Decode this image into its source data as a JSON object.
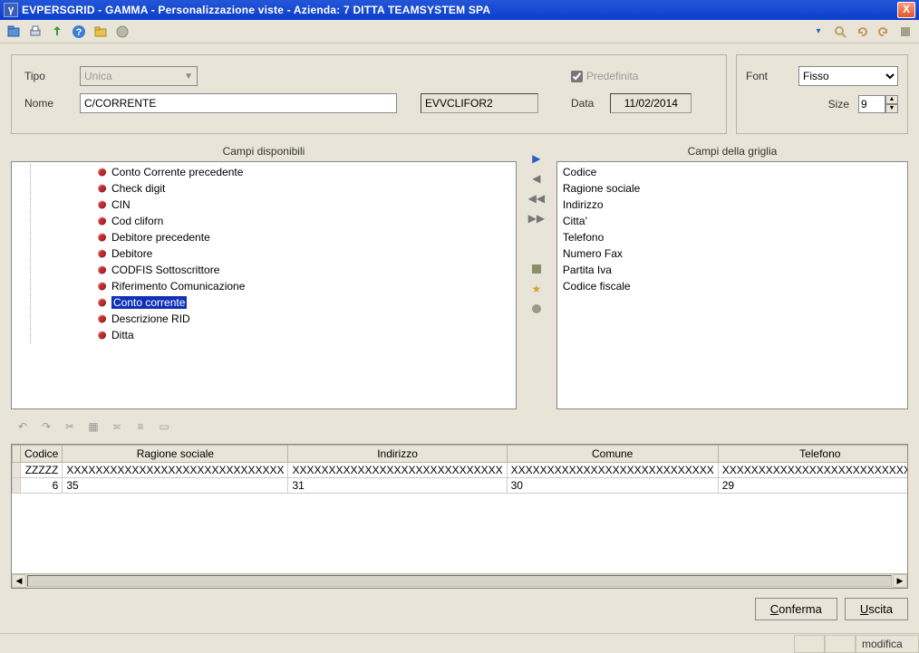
{
  "window": {
    "title": "EVPERSGRID - GAMMA - Personalizzazione viste - Azienda:     7 DITTA TEAMSYSTEM SPA",
    "close": "X"
  },
  "toolbar_right": {
    "dropdown_glyph": "▾"
  },
  "labels": {
    "tipo": "Tipo",
    "nome": "Nome",
    "predefinita": "Predefinita",
    "data": "Data",
    "font": "Font",
    "size": "Size",
    "campi_disponibili": "Campi disponibili",
    "campi_griglia": "Campi della griglia"
  },
  "values": {
    "tipo": "Unica",
    "nome": "C/CORRENTE",
    "code": "EVVCLIFOR2",
    "predefinita_checked": true,
    "data": "11/02/2014",
    "font": "Fisso",
    "size": "9"
  },
  "available_fields": [
    "Conto Corrente precedente",
    "Check digit",
    "CIN",
    "Cod cliforn",
    "Debitore precedente",
    "Debitore",
    "CODFIS Sottoscrittore",
    "Riferimento Comunicazione",
    "Conto corrente",
    "Descrizione RID",
    "Ditta"
  ],
  "available_selected_index": 8,
  "grid_fields": [
    "Codice",
    "Ragione sociale",
    "Indirizzo",
    "Citta'",
    "Telefono",
    "Numero  Fax",
    "Partita Iva",
    "Codice fiscale"
  ],
  "preview": {
    "headers": [
      "Codice",
      "Ragione sociale",
      "Indirizzo",
      "Comune",
      "Telefono"
    ],
    "rows": [
      [
        "ZZZZZ",
        "XXXXXXXXXXXXXXXXXXXXXXXXXXXXXX",
        "XXXXXXXXXXXXXXXXXXXXXXXXXXXXX",
        "XXXXXXXXXXXXXXXXXXXXXXXXXXXX",
        "XXXXXXXXXXXXXXXXXXXXXXXXXXX"
      ],
      [
        "6",
        "35",
        "31",
        "30",
        "29"
      ]
    ]
  },
  "buttons": {
    "conferma": "Conferma",
    "uscita": "Uscita"
  },
  "status": {
    "modifica": "modifica"
  }
}
